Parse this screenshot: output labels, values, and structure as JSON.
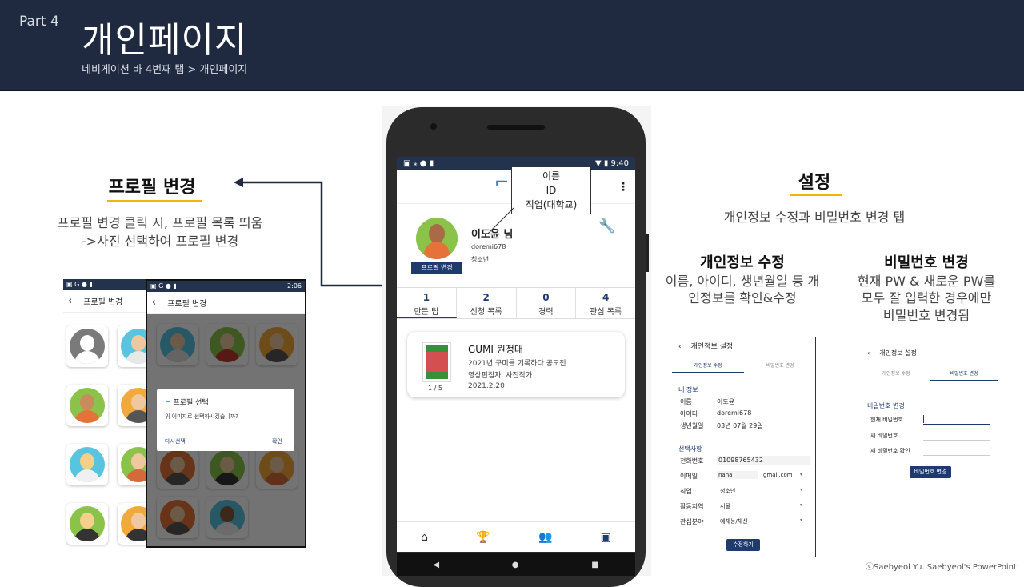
{
  "header": {
    "part": "Part 4",
    "title": "개인페이지",
    "subtitle": "네비게이션 바 4번째 탭 > 개인페이지"
  },
  "profile_change": {
    "title": "프로필 변경",
    "desc1": "프로필 변경 클릭 시, 프로필 목록 띄움",
    "desc2": "->사진 선택하여 프로필 변경",
    "screen_title": "프로필 변경",
    "time": "2:06",
    "dialog": {
      "title": "프로필 선택",
      "message": "위 이미지로 선택하시겠습니까?",
      "cancel": "다시선택",
      "confirm": "확인"
    }
  },
  "phone": {
    "time": "9:40",
    "callout": [
      "이름",
      "ID",
      "직업(대학교)"
    ],
    "user": {
      "name": "이도윤 님",
      "id": "doremi678",
      "job": "청소년",
      "edit_button": "프로필 변경"
    },
    "stats": [
      {
        "n": "1",
        "label": "만든 팁"
      },
      {
        "n": "2",
        "label": "신청 목록"
      },
      {
        "n": "0",
        "label": "경력"
      },
      {
        "n": "4",
        "label": "관심 목록"
      }
    ],
    "card": {
      "title": "GUMI 원정대",
      "line1": "2021년 구미를 기록하다 공모전",
      "line2": "영상편집자, 사진작가",
      "date": "2021.2.20",
      "pager": "1 / 5"
    },
    "nav_icons": [
      "home-icon",
      "trophy-icon",
      "group-icon",
      "contact-icon"
    ],
    "nav": [
      "⌂",
      "🏆",
      "👥",
      "▣"
    ],
    "soft_keys": [
      "◀",
      "●",
      "■"
    ]
  },
  "settings": {
    "title": "설정",
    "desc": "개인정보 수정과 비밀번호 변경 탭",
    "info": {
      "title": "개인정보 수정",
      "desc1": "이름, 아이디, 생년월일 등 개",
      "desc2": "인정보를 확인&수정"
    },
    "pw": {
      "title": "비밀번호 변경",
      "desc1": "현재 PW & 새로운 PW를",
      "desc2": "모두 잘 입력한 경우에만",
      "desc3": "비밀번호 변경됨"
    },
    "screen1": {
      "title": "개인정보 설정",
      "tab1": "개인정보 수정",
      "tab2": "비밀번호 변경",
      "sec1": "내 정보",
      "rows": [
        [
          "이름",
          "이도윤"
        ],
        [
          "아이디",
          "doremi678"
        ],
        [
          "생년월일",
          "03년 07월 29일"
        ]
      ],
      "sec2": "선택사항",
      "phone_label": "전화번호",
      "phone": "01098765432",
      "email_label": "이메일",
      "email_id": "nana",
      "email_domain": "gmail.com",
      "selects": [
        [
          "직업",
          "청소년"
        ],
        [
          "활동지역",
          "서울"
        ],
        [
          "관심분야",
          "예체능/체션"
        ]
      ],
      "button": "수정하기"
    },
    "screen2": {
      "title": "개인정보 설정",
      "tab1": "개인정보 수정",
      "tab2": "비밀번호 변경",
      "sec": "비밀번호 변경",
      "fields": [
        "현재 비밀번호",
        "새 비밀번호",
        "새 비밀번호 확인"
      ],
      "button": "비밀번호 변경"
    }
  },
  "copyright": "ⓒSaebyeol Yu. Saebyeol's PowerPoint"
}
